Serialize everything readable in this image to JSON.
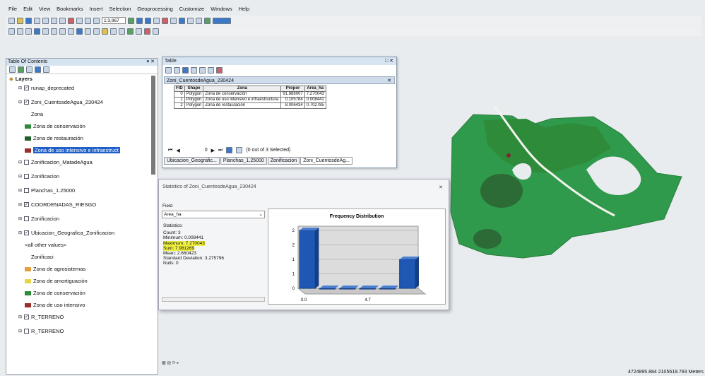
{
  "menubar": {
    "items": [
      "File",
      "Edit",
      "View",
      "Bookmarks",
      "Insert",
      "Selection",
      "Geoprocessing",
      "Customize",
      "Windows",
      "Help"
    ]
  },
  "toolbar": {
    "scale": "1:3,967"
  },
  "toc": {
    "title": "Table Of Contents",
    "layers_root": "Layers",
    "layers": [
      {
        "label": "runap_deprecated",
        "indent": 1,
        "check": true
      },
      {
        "label": "Zoni_CuentosdeAgua_230424",
        "indent": 1,
        "check": true
      },
      {
        "label": "Zona",
        "indent": 3
      },
      {
        "label": "Zona de conservación",
        "indent": 2,
        "swatch": "#2e8b3a"
      },
      {
        "label": "Zona de restauración",
        "indent": 2,
        "swatch": "#1f5f2a"
      },
      {
        "label": "Zona de uso intensivo e infraestruct",
        "indent": 2,
        "swatch": "#9b2d2d",
        "highlight": true
      },
      {
        "label": "Zonificacion_MatadeAgua",
        "indent": 1,
        "check": false
      },
      {
        "label": "Zonificacion",
        "indent": 1,
        "check": false
      },
      {
        "label": "Planchas_1.25000",
        "indent": 1,
        "check": false
      },
      {
        "label": "COORDENADAS_RIESGO",
        "indent": 1,
        "check": true
      },
      {
        "label": "Zonificacion",
        "indent": 1,
        "check": false
      },
      {
        "label": "Ubicacion_Geografica_Zonificacion",
        "indent": 1,
        "check": true
      },
      {
        "label": "<all other values>",
        "indent": 2
      },
      {
        "label": "Zonificaci",
        "indent": 3
      },
      {
        "label": "Zona de agrosistemas",
        "indent": 2,
        "swatch": "#e0a040"
      },
      {
        "label": "Zona de amortiguación",
        "indent": 2,
        "swatch": "#e8d44a"
      },
      {
        "label": "Zona de conservación",
        "indent": 2,
        "swatch": "#2e8b3a"
      },
      {
        "label": "Zona de uso intensivo",
        "indent": 2,
        "swatch": "#9b2d2d"
      },
      {
        "label": "R_TERRENO",
        "indent": 1,
        "check": true
      },
      {
        "label": "R_TERRENO",
        "indent": 1,
        "check": false
      }
    ]
  },
  "table": {
    "title": "Table",
    "subtitle": "Zoni_CuentosdeAgua_230424",
    "headers": [
      "FID",
      "Shape",
      "Zona",
      "Propor",
      "Area_ha"
    ],
    "rows": [
      [
        "0",
        "Polygon",
        "Zona de conservación",
        "91.888007",
        "7.270043"
      ],
      [
        "1",
        "Polygon",
        "Zona de uso intensivo e infraestructura",
        "0.105784",
        "0.008441"
      ],
      [
        "2",
        "Polygon",
        "Zona de restauración",
        "8.006434",
        "0.702785"
      ]
    ],
    "nav_record": "0",
    "selected_text": "(0 out of 3 Selected)",
    "tabs": [
      "Ubicacion_Geografic...",
      "Planchas_1.25000",
      "Zonificacion",
      "Zoni_CuentosdeAg..."
    ]
  },
  "stats": {
    "title": "Statistics of Zoni_CuentosdeAgua_230424",
    "field_label": "Field",
    "field_value": "Area_ha",
    "statistics_label": "Statistics:",
    "count": "Count:  3",
    "minimum": "Minimum: 0.008441",
    "maximum": "Maximum: 7.270043",
    "sum": "Sum:    7.981269",
    "mean": "Mean:   2.660423",
    "stddev": "Standard Deviation: 3.275796",
    "nulls": "Nulls:   0"
  },
  "chart_data": {
    "type": "bar",
    "title": "Frequency Distribution",
    "categories": [
      "0.0",
      "4.7"
    ],
    "values": [
      2,
      0,
      0,
      0,
      0,
      1
    ],
    "yticks": [
      "0",
      "1",
      "1",
      "2",
      "2"
    ],
    "colors": {
      "bar": "#1f57b4",
      "wall": "#dcdcdc"
    }
  },
  "map": {
    "coords": "4724895.884  2105619.783 Meters",
    "colors": {
      "poly": "#2f9a4b",
      "dark": "#2c6a36",
      "red": "#7a2a2a"
    }
  }
}
